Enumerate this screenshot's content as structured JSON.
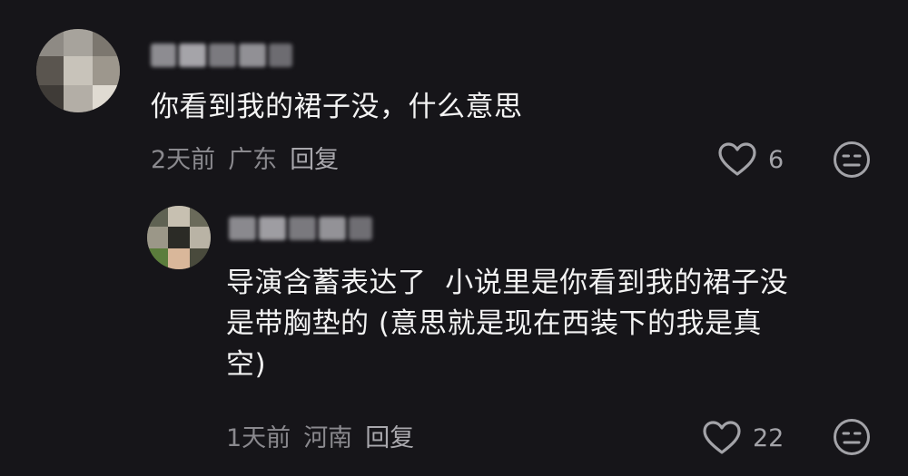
{
  "comments": [
    {
      "text": "你看到我的裙子没，什么意思",
      "time": "2天前",
      "location": "广东",
      "reply_label": "回复",
      "likes": "6",
      "like_icon": "heart-outline-icon",
      "dislike_icon": "neutral-face-icon"
    },
    {
      "text": "导演含蓄表达了  小说里是你看到我的裙子没\n是带胸垫的 (意思就是现在西装下的我是真\n空)",
      "time": "1天前",
      "location": "河南",
      "reply_label": "回复",
      "likes": "22",
      "like_icon": "heart-outline-icon",
      "dislike_icon": "neutral-face-icon"
    }
  ],
  "colors": {
    "background": "#161519",
    "text": "#f3f3f3",
    "meta": "#8a898e",
    "icon": "#a3a3a8"
  }
}
